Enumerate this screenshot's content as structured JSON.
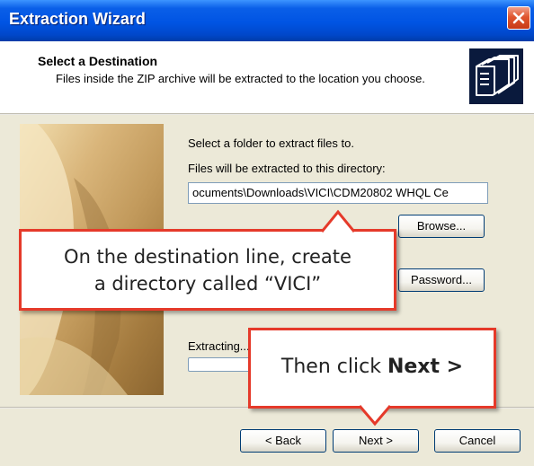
{
  "window": {
    "title": "Extraction Wizard"
  },
  "header": {
    "title": "Select a Destination",
    "description": "Files inside the ZIP archive will be extracted to the location you choose."
  },
  "body": {
    "select_folder_label": "Select a folder to extract files to.",
    "directory_label": "Files will be extracted to this directory:",
    "directory_value": "ocuments\\Downloads\\VICI\\CDM20802 WHQL Ce",
    "browse_label": "Browse...",
    "password_label": "Password...",
    "extracting_label": "Extracting..."
  },
  "footer": {
    "back_label": "< Back",
    "next_label": "Next >",
    "cancel_label": "Cancel"
  },
  "annotations": {
    "callout1_line1": "On the destination line, create",
    "callout1_line2": "a directory called “VICI”",
    "callout2_prefix": "Then click ",
    "callout2_bold": "Next >"
  },
  "colors": {
    "titlebar": "#0054e3",
    "dialog": "#ece9d8",
    "callout_border": "#e53a2a",
    "close_button": "#e0562f"
  },
  "icons": [
    "close-icon",
    "folders-icon"
  ]
}
